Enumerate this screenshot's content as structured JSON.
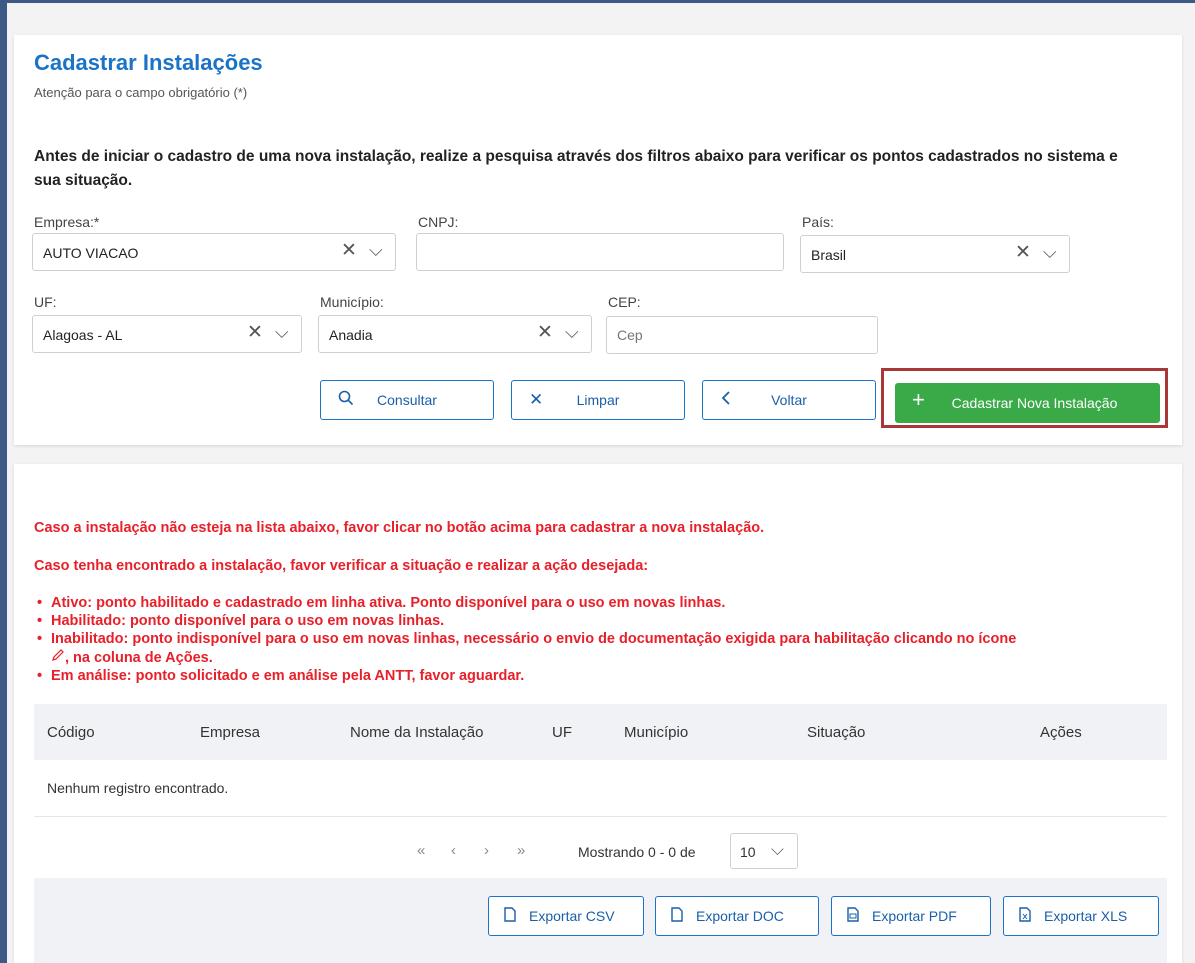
{
  "page": {
    "title": "Cadastrar Instalações",
    "subtitle": "Atenção para o campo obrigatório (*)",
    "instructions": "Antes de iniciar o cadastro de uma nova instalação, realize a pesquisa através dos filtros abaixo para verificar os pontos cadastrados no sistema e sua situação."
  },
  "filters": {
    "empresa": {
      "label": "Empresa:*",
      "value": "AUTO VIACAO"
    },
    "cnpj": {
      "label": "CNPJ:",
      "value": ""
    },
    "pais": {
      "label": "País:",
      "value": "Brasil"
    },
    "uf": {
      "label": "UF:",
      "value": "Alagoas - AL"
    },
    "municipio": {
      "label": "Município:",
      "value": "Anadia"
    },
    "cep": {
      "label": "CEP:",
      "placeholder": "Cep"
    }
  },
  "buttons": {
    "consultar": "Consultar",
    "limpar": "Limpar",
    "voltar": "Voltar",
    "cadastrar": "Cadastrar Nova Instalação"
  },
  "notices": {
    "line1": "Caso a instalação não esteja na lista abaixo, favor clicar no botão acima para cadastrar a nova instalação.",
    "line2": "Caso tenha encontrado a instalação, favor verificar a situação e realizar a ação desejada:",
    "items": [
      "Ativo: ponto habilitado e cadastrado em linha ativa. Ponto disponível para o uso em novas linhas.",
      "Habilitado: ponto disponível para o uso em novas linhas.",
      "Inabilitado: ponto indisponível para o uso em novas linhas, necessário o envio de documentação exigida para habilitação clicando no ícone",
      ", na coluna de Ações.",
      "Em análise: ponto solicitado e em análise pela ANTT, favor aguardar."
    ]
  },
  "table": {
    "columns": [
      "Código",
      "Empresa",
      "Nome da Instalação",
      "UF",
      "Município",
      "Situação",
      "Ações"
    ],
    "empty_message": "Nenhum registro encontrado."
  },
  "pagination": {
    "status": "Mostrando 0 - 0 de",
    "page_size": "10"
  },
  "exports": [
    "Exportar CSV",
    "Exportar DOC",
    "Exportar PDF",
    "Exportar XLS"
  ],
  "colors": {
    "title": "#1a73c6",
    "primary_border": "#1a73c6",
    "success": "#3aaa48",
    "notice": "#e8202a",
    "highlight": "#a83838"
  },
  "icons": {
    "clear": "x-icon",
    "dropdown": "chevron-down-icon",
    "search": "search-icon",
    "back": "chevron-left-icon",
    "add": "plus-icon",
    "edit": "pencil-icon",
    "file": "file-icon"
  }
}
